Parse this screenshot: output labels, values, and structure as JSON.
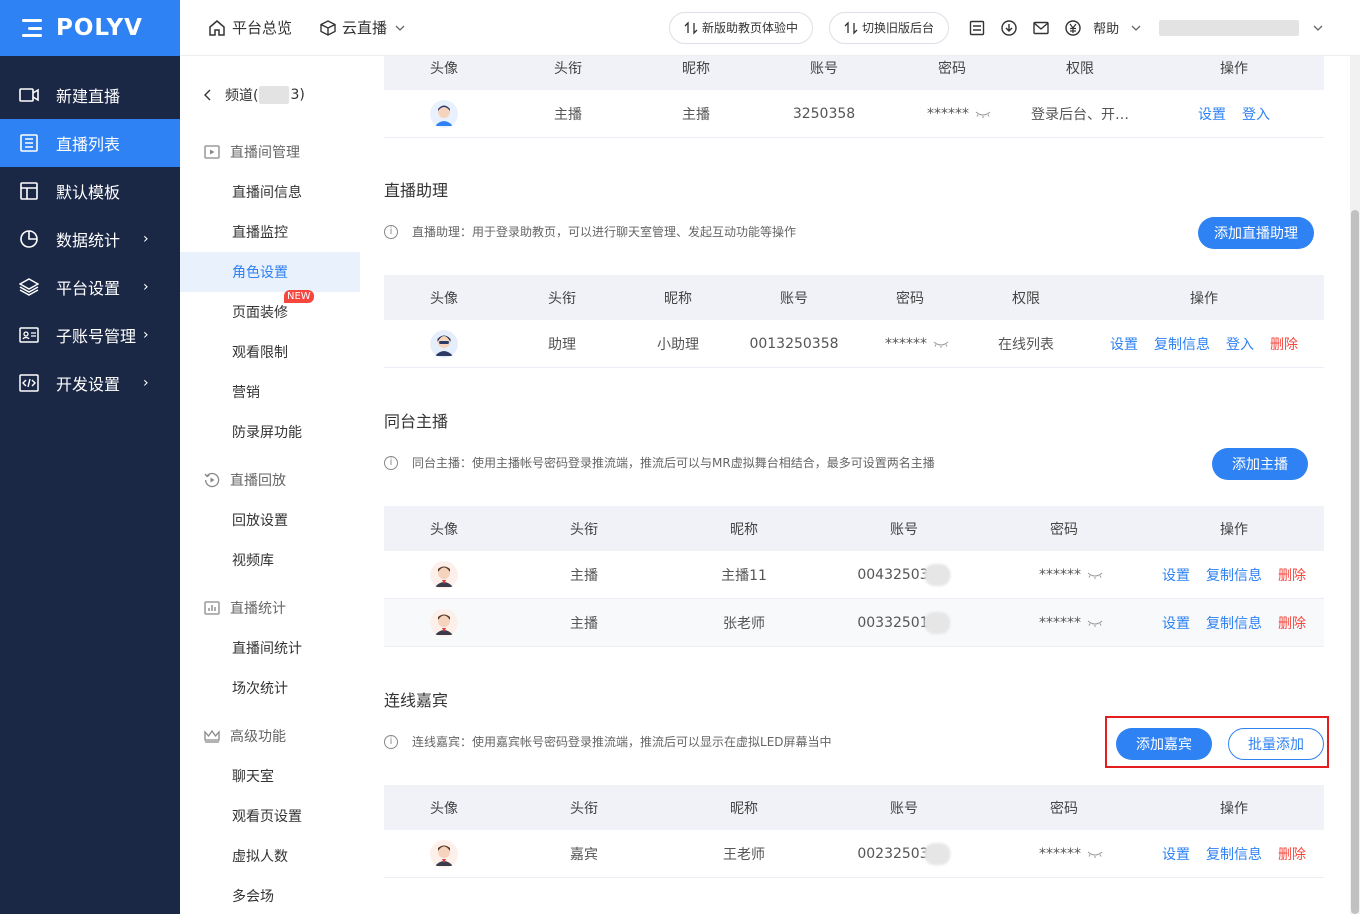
{
  "brand": {
    "logo": "POLYV"
  },
  "leftnav": [
    {
      "label": "新建直播",
      "icon": "video-icon",
      "arrow": ""
    },
    {
      "label": "直播列表",
      "icon": "list-icon",
      "arrow": "",
      "active": true
    },
    {
      "label": "默认模板",
      "icon": "template-icon",
      "arrow": ""
    },
    {
      "label": "数据统计",
      "icon": "chart-icon",
      "arrow": "›"
    },
    {
      "label": "平台设置",
      "icon": "layers-icon",
      "arrow": "›"
    },
    {
      "label": "子账号管理",
      "icon": "id-card-icon",
      "arrow": "›"
    },
    {
      "label": "开发设置",
      "icon": "code-icon",
      "arrow": "›"
    }
  ],
  "topbar": {
    "home": "平台总览",
    "live": "云直播",
    "btn_new": "新版助教页体验中",
    "btn_old": "切换旧版后台",
    "help": "帮助"
  },
  "subnav": {
    "back": "频道(",
    "back_suffix": "3)",
    "groups": [
      {
        "title": "直播间管理",
        "items": [
          "直播间信息",
          "直播监控",
          "角色设置",
          "页面装修",
          "观看限制",
          "营销",
          "防录屏功能"
        ]
      },
      {
        "title": "直播回放",
        "items": [
          "回放设置",
          "视频库"
        ]
      },
      {
        "title": "直播统计",
        "items": [
          "直播间统计",
          "场次统计"
        ]
      },
      {
        "title": "高级功能",
        "items": [
          "聊天室",
          "观看页设置",
          "虚拟人数",
          "多会场"
        ]
      }
    ],
    "new_badge": "NEW"
  },
  "host_table": {
    "headers": [
      "头像",
      "头衔",
      "昵称",
      "账号",
      "密码",
      "权限",
      "操作"
    ],
    "row": {
      "title": "主播",
      "nick": "主播",
      "account": "3250358",
      "pwd": "******",
      "perm": "登录后台、开…",
      "ops": [
        "设置",
        "登入"
      ]
    }
  },
  "assistant": {
    "title": "直播助理",
    "desc": "直播助理：用于登录助教页，可以进行聊天室管理、发起互动功能等操作",
    "add_btn": "添加直播助理",
    "headers": [
      "头像",
      "头衔",
      "昵称",
      "账号",
      "密码",
      "权限",
      "操作"
    ],
    "row": {
      "title": "助理",
      "nick": "小助理",
      "account": "0013250358",
      "pwd": "******",
      "perm": "在线列表",
      "ops": [
        "设置",
        "复制信息",
        "登入",
        "删除"
      ]
    }
  },
  "cohost": {
    "title": "同台主播",
    "desc": "同台主播：使用主播帐号密码登录推流端，推流后可以与MR虚拟舞台相结合，最多可设置两名主播",
    "add_btn": "添加主播",
    "headers": [
      "头像",
      "头衔",
      "昵称",
      "账号",
      "密码",
      "操作"
    ],
    "rows": [
      {
        "title": "主播",
        "nick": "主播11",
        "account": "00432503",
        "pwd": "******",
        "ops": [
          "设置",
          "复制信息",
          "删除"
        ]
      },
      {
        "title": "主播",
        "nick": "张老师",
        "account": "00332501",
        "pwd": "******",
        "ops": [
          "设置",
          "复制信息",
          "删除"
        ]
      }
    ]
  },
  "guest": {
    "title": "连线嘉宾",
    "desc": "连线嘉宾：使用嘉宾帐号密码登录推流端，推流后可以显示在虚拟LED屏幕当中",
    "add_btn": "添加嘉宾",
    "batch_btn": "批量添加",
    "headers": [
      "头像",
      "头衔",
      "昵称",
      "账号",
      "密码",
      "操作"
    ],
    "row": {
      "title": "嘉宾",
      "nick": "王老师",
      "account": "00232503",
      "pwd": "******",
      "ops": [
        "设置",
        "复制信息",
        "删除"
      ]
    }
  },
  "colors": {
    "primary": "#2f82f3",
    "nav_bg": "#1a2745",
    "danger": "#f5473d",
    "highlight": "#e41e1e"
  }
}
